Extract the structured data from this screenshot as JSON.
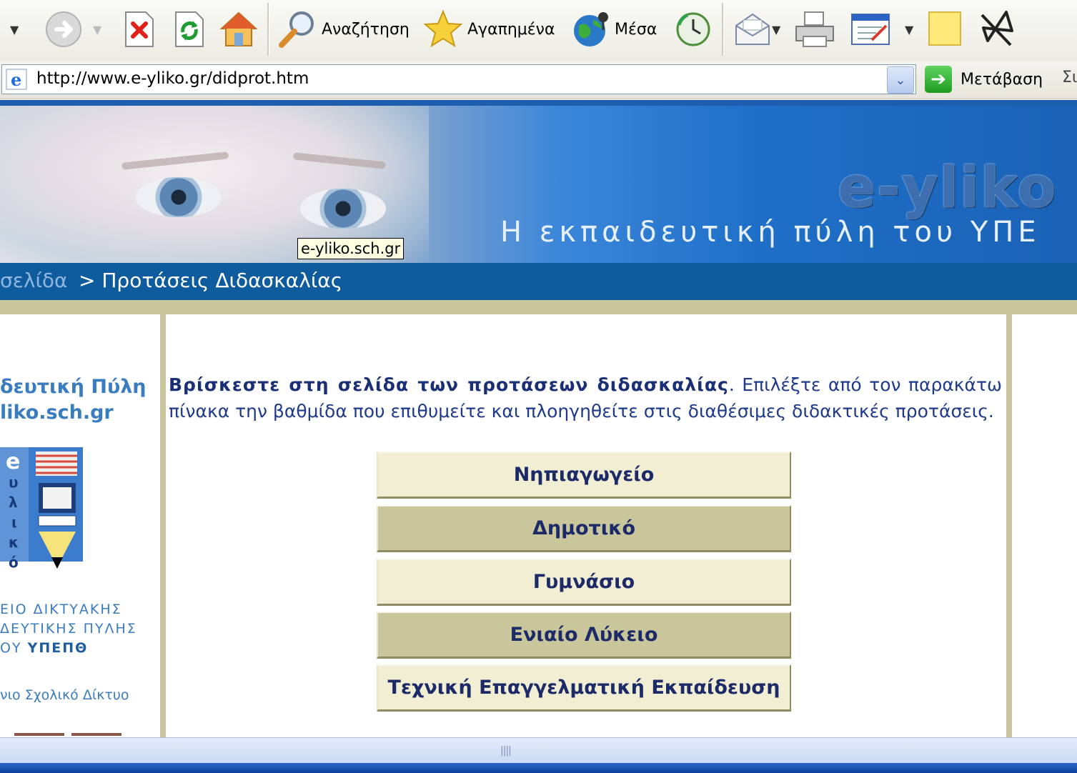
{
  "toolbar": {
    "search_label": "Αναζήτηση",
    "favorites_label": "Αγαπημένα",
    "media_label": "Μέσα"
  },
  "addressbar": {
    "url": "http://www.e-yliko.gr/didprot.htm",
    "go_label": "Μετάβαση",
    "links_label": "Σι"
  },
  "banner": {
    "logo": "e-yliko",
    "subtitle": "Η εκπαιδευτική πύλη του ΥΠΕ",
    "tooltip": "e-yliko.sch.gr"
  },
  "breadcrumb": {
    "home": "σελίδα",
    "separator": ">",
    "current": "Προτάσεις Διδασκαλίας"
  },
  "sidebar": {
    "portal_line1": "δευτική Πύλη",
    "portal_line2": "liko.sch.gr",
    "logo_letters": "e υ λ ι κ ό",
    "ministry_line1": "ΕΙΟ ΔΙΚΤΥΑΚΗΣ",
    "ministry_line2": "ΔΕΥΤΙΚΗΣ ΠΥΛΗΣ",
    "ministry_line3a": "ΟΥ ",
    "ministry_line3b": "ΥΠΕΠΘ",
    "school_network": "νιο Σχολικό Δίκτυο"
  },
  "main": {
    "intro_bold": "Βρίσκεστε στη σελίδα των προτάσεων διδασκαλίας",
    "intro_rest": ". Επιλέξτε από τον παρακάτω πίνακα την βαθμίδα που επιθυμείτε και πλοηγηθείτε στις διαθέσιμες διδακτικές προτάσεις.",
    "levels": [
      "Νηπιαγωγείο",
      "Δημοτικό",
      "Γυμνάσιο",
      "Ενιαίο Λύκειο",
      "Τεχνική Επαγγελματική Εκπαίδευση"
    ]
  },
  "colors": {
    "banner_blue": "#1f6fc8",
    "crumb_bar": "#0e5b9d",
    "olive": "#c9c59c",
    "button_light": "#f1eed3",
    "button_dark": "#cac69c",
    "text_navy": "#1d2a68",
    "link_blue": "#3a7cc0"
  }
}
